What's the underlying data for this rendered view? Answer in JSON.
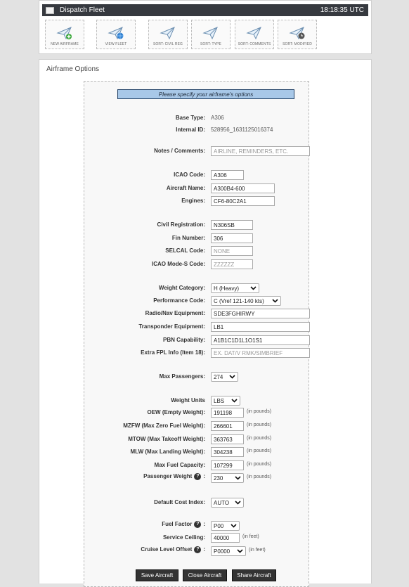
{
  "window": {
    "title": "Dispatch Fleet",
    "clock": "18:18:35 UTC"
  },
  "toolbar": {
    "buttons": [
      {
        "label": "NEW AIRFRAME",
        "icon": "plane-add-icon"
      },
      {
        "label": "VIEW FLEET",
        "icon": "plane-globe-icon"
      },
      {
        "label": "SORT: CIVIL REG",
        "icon": "plane-icon"
      },
      {
        "label": "SORT: TYPE",
        "icon": "plane-icon"
      },
      {
        "label": "SORT: COMMENTS",
        "icon": "plane-icon"
      },
      {
        "label": "SORT: MODIFIED",
        "icon": "plane-clock-icon"
      }
    ]
  },
  "panel": {
    "title": "Airframe Options",
    "banner": "Please specify your airframe's options"
  },
  "form": {
    "base_type": {
      "label": "Base Type:",
      "value": "A306"
    },
    "internal_id": {
      "label": "Internal ID:",
      "value": "528956_1631125016374"
    },
    "notes": {
      "label": "Notes / Comments:",
      "placeholder": "AIRLINE, REMINDERS, ETC."
    },
    "icao_code": {
      "label": "ICAO Code:",
      "value": "A306"
    },
    "aircraft_name": {
      "label": "Aircraft Name:",
      "value": "A300B4-600"
    },
    "engines": {
      "label": "Engines:",
      "value": "CF6-80C2A1"
    },
    "civil_registration": {
      "label": "Civil Registration:",
      "value": "N306SB"
    },
    "fin_number": {
      "label": "Fin Number:",
      "value": "306"
    },
    "selcal": {
      "label": "SELCAL Code:",
      "placeholder": "NONE"
    },
    "mode_s": {
      "label": "ICAO Mode-S Code:",
      "placeholder": "ZZZZZZ"
    },
    "weight_category": {
      "label": "Weight Category:",
      "value": "H (Heavy)"
    },
    "performance_code": {
      "label": "Performance Code:",
      "value": "C (Vref 121-140 kts)"
    },
    "radio_nav": {
      "label": "Radio/Nav Equipment:",
      "value": "SDE3FGHIRWY"
    },
    "transponder": {
      "label": "Transponder Equipment:",
      "value": "LB1"
    },
    "pbn": {
      "label": "PBN Capability:",
      "value": "A1B1C1D1L1O1S1"
    },
    "extra_fpl": {
      "label": "Extra FPL Info (Item 18):",
      "placeholder": "EX. DAT/V RMK/SIMBRIEF"
    },
    "max_passengers": {
      "label": "Max Passengers:",
      "value": "274"
    },
    "weight_units": {
      "label": "Weight Units",
      "value": "LBS"
    },
    "oew": {
      "label": "OEW (Empty Weight):",
      "value": "191198",
      "unit": "(in pounds)"
    },
    "mzfw": {
      "label": "MZFW (Max Zero Fuel Weight):",
      "value": "266601",
      "unit": "(in pounds)"
    },
    "mtow": {
      "label": "MTOW (Max Takeoff Weight):",
      "value": "363763",
      "unit": "(in pounds)"
    },
    "mlw": {
      "label": "MLW (Max Landing Weight):",
      "value": "304238",
      "unit": "(in pounds)"
    },
    "max_fuel": {
      "label": "Max Fuel Capacity:",
      "value": "107299",
      "unit": "(in pounds)"
    },
    "pax_weight": {
      "label": "Passenger Weight",
      "value": "230",
      "unit": "(in pounds)"
    },
    "cost_index": {
      "label": "Default Cost Index:",
      "value": "AUTO"
    },
    "fuel_factor": {
      "label": "Fuel Factor",
      "value": "P00"
    },
    "service_ceiling": {
      "label": "Service Ceiling:",
      "value": "40000",
      "unit": "(in feet)"
    },
    "cruise_offset": {
      "label": "Cruise Level Offset",
      "value": "P0000",
      "unit": "(in feet)"
    },
    "colon": ":"
  },
  "actions": {
    "save": "Save Aircraft",
    "close": "Close Aircraft",
    "share": "Share Aircraft"
  }
}
